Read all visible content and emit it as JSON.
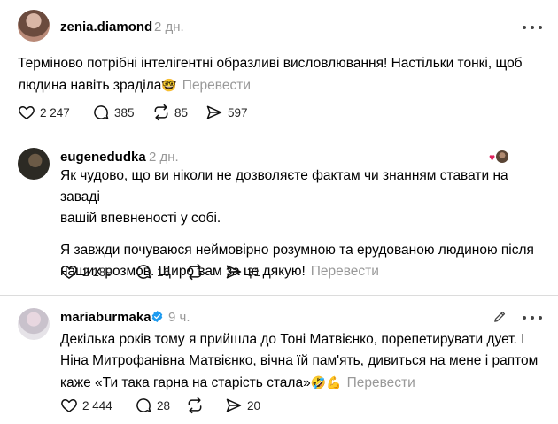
{
  "posts": [
    {
      "username": "zenia.diamond",
      "time": "2 дн.",
      "lines": [
        "Терміново потрібні інтелігентні образливі висловлювання! Настільки тонкі, щоб",
        "людина навіть зраділа"
      ],
      "emoji": "🤓",
      "translate": "Перевести",
      "likes": "2 247",
      "comments": "385",
      "reposts": "85",
      "shares": "597"
    },
    {
      "username": "eugenedudka",
      "time": "2 дн.",
      "paragraph1": [
        "Як чудово, що ви ніколи не дозволяєте фактам чи знанням ставати на заваді",
        "вашій впевненості у собі."
      ],
      "paragraph2": [
        "Я завжди почуваюся неймовірно розумною та ерудованою людиною після",
        "наших розмов. Щиро вам за це дякую!"
      ],
      "translate": "Перевести",
      "likes": "2 189",
      "comments": "16",
      "reposts": "",
      "shares": "31",
      "liked_by_icon": "heart-with-avatar-icon"
    },
    {
      "username": "mariaburmaka",
      "time": "9 ч.",
      "verified": true,
      "lines": [
        "Декілька років тому я прийшла до Тоні Матвієнко, порепетирувати дует. І",
        "Ніна Митрофанівна Матвієнко, вічна їй пам'ять, дивиться на мене і раптом",
        "каже «Ти така гарна на старість стала»"
      ],
      "emoji": "🤣💪",
      "translate": "Перевести",
      "likes": "2 444",
      "comments": "28",
      "reposts": "",
      "shares": "20"
    }
  ],
  "colors": {
    "muted": "#999999",
    "divider": "#dcdcdc",
    "verified": "#1d9bf0",
    "heart_red": "#e0245e"
  }
}
